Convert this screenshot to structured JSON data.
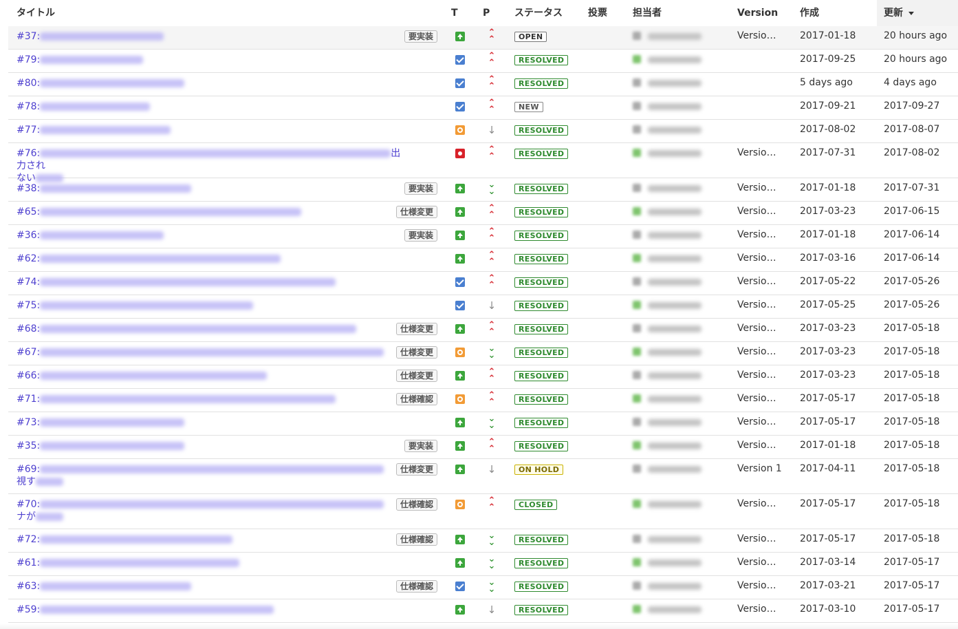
{
  "header": {
    "title": "タイトル",
    "t": "T",
    "p": "P",
    "status": "ステータス",
    "votes": "投票",
    "assignee": "担当者",
    "version": "Version",
    "created": "作成",
    "updated": "更新"
  },
  "rows": [
    {
      "num": "#37:",
      "tag": "要実装",
      "type": "up",
      "priority": "high",
      "status": "OPEN",
      "version": "Versio…",
      "created": "2017-01-18",
      "updated": "20 hours ago",
      "lines": 1
    },
    {
      "num": "#79:",
      "tag": "",
      "type": "check",
      "priority": "high",
      "status": "RESOLVED",
      "version": "",
      "created": "2017-09-25",
      "updated": "20 hours ago",
      "lines": 1
    },
    {
      "num": "#80:",
      "tag": "",
      "type": "check",
      "priority": "high",
      "status": "RESOLVED",
      "version": "",
      "created": "5 days ago",
      "updated": "4 days ago",
      "lines": 1
    },
    {
      "num": "#78:",
      "tag": "",
      "type": "check",
      "priority": "high",
      "status": "NEW",
      "version": "",
      "created": "2017-09-21",
      "updated": "2017-09-27",
      "lines": 1
    },
    {
      "num": "#77:",
      "tag": "",
      "type": "idea",
      "priority": "none",
      "status": "RESOLVED",
      "version": "",
      "created": "2017-08-02",
      "updated": "2017-08-07",
      "lines": 1
    },
    {
      "num": "#76:",
      "tag": "",
      "type": "bug",
      "priority": "high",
      "status": "RESOLVED",
      "version": "Versio…",
      "created": "2017-07-31",
      "updated": "2017-08-02",
      "lines": 2,
      "tail": "出力され",
      "line2": "ない"
    },
    {
      "num": "#38:",
      "tag": "要実装",
      "type": "up",
      "priority": "low",
      "status": "RESOLVED",
      "version": "Versio…",
      "created": "2017-01-18",
      "updated": "2017-07-31",
      "lines": 1
    },
    {
      "num": "#65:",
      "tag": "仕様変更",
      "type": "up",
      "priority": "high",
      "status": "RESOLVED",
      "version": "Versio…",
      "created": "2017-03-23",
      "updated": "2017-06-15",
      "lines": 1
    },
    {
      "num": "#36:",
      "tag": "要実装",
      "type": "up",
      "priority": "high",
      "status": "RESOLVED",
      "version": "Versio…",
      "created": "2017-01-18",
      "updated": "2017-06-14",
      "lines": 1
    },
    {
      "num": "#62:",
      "tag": "",
      "type": "up",
      "priority": "high",
      "status": "RESOLVED",
      "version": "Versio…",
      "created": "2017-03-16",
      "updated": "2017-06-14",
      "lines": 1
    },
    {
      "num": "#74:",
      "tag": "",
      "type": "check",
      "priority": "high",
      "status": "RESOLVED",
      "version": "Versio…",
      "created": "2017-05-22",
      "updated": "2017-05-26",
      "lines": 1
    },
    {
      "num": "#75:",
      "tag": "",
      "type": "check",
      "priority": "none",
      "status": "RESOLVED",
      "version": "Versio…",
      "created": "2017-05-25",
      "updated": "2017-05-26",
      "lines": 1
    },
    {
      "num": "#68:",
      "tag": "仕様変更",
      "type": "up",
      "priority": "high",
      "status": "RESOLVED",
      "version": "Versio…",
      "created": "2017-03-23",
      "updated": "2017-05-18",
      "lines": 1
    },
    {
      "num": "#67:",
      "tag": "仕様変更",
      "type": "idea",
      "priority": "low",
      "status": "RESOLVED",
      "version": "Versio…",
      "created": "2017-03-23",
      "updated": "2017-05-18",
      "lines": 1
    },
    {
      "num": "#66:",
      "tag": "仕様変更",
      "type": "up",
      "priority": "high",
      "status": "RESOLVED",
      "version": "Versio…",
      "created": "2017-03-23",
      "updated": "2017-05-18",
      "lines": 1
    },
    {
      "num": "#71:",
      "tag": "仕様確認",
      "type": "idea",
      "priority": "high",
      "status": "RESOLVED",
      "version": "Versio…",
      "created": "2017-05-17",
      "updated": "2017-05-18",
      "lines": 1
    },
    {
      "num": "#73:",
      "tag": "",
      "type": "up",
      "priority": "low",
      "status": "RESOLVED",
      "version": "Versio…",
      "created": "2017-05-17",
      "updated": "2017-05-18",
      "lines": 1
    },
    {
      "num": "#35:",
      "tag": "要実装",
      "type": "up",
      "priority": "high",
      "status": "RESOLVED",
      "version": "Versio…",
      "created": "2017-01-18",
      "updated": "2017-05-18",
      "lines": 1
    },
    {
      "num": "#69:",
      "tag": "仕様変更",
      "type": "up",
      "priority": "none",
      "status": "ON HOLD",
      "version": "Version 1",
      "created": "2017-04-11",
      "updated": "2017-05-18",
      "lines": 2,
      "tail": "",
      "line2": "視す"
    },
    {
      "num": "#70:",
      "tag": "仕様確認",
      "type": "idea",
      "priority": "high",
      "status": "CLOSED",
      "version": "Versio…",
      "created": "2017-05-17",
      "updated": "2017-05-18",
      "lines": 2,
      "tail": "",
      "line2": "ナが"
    },
    {
      "num": "#72:",
      "tag": "仕様確認",
      "type": "up",
      "priority": "low",
      "status": "RESOLVED",
      "version": "Versio…",
      "created": "2017-05-17",
      "updated": "2017-05-18",
      "lines": 1
    },
    {
      "num": "#61:",
      "tag": "",
      "type": "up",
      "priority": "low",
      "status": "RESOLVED",
      "version": "Versio…",
      "created": "2017-03-14",
      "updated": "2017-05-17",
      "lines": 1
    },
    {
      "num": "#63:",
      "tag": "仕様確認",
      "type": "check",
      "priority": "low",
      "status": "RESOLVED",
      "version": "Versio…",
      "created": "2017-03-21",
      "updated": "2017-05-17",
      "lines": 1
    },
    {
      "num": "#59:",
      "tag": "",
      "type": "up",
      "priority": "none",
      "status": "RESOLVED",
      "version": "Versio…",
      "created": "2017-03-10",
      "updated": "2017-05-17",
      "lines": 1
    }
  ]
}
